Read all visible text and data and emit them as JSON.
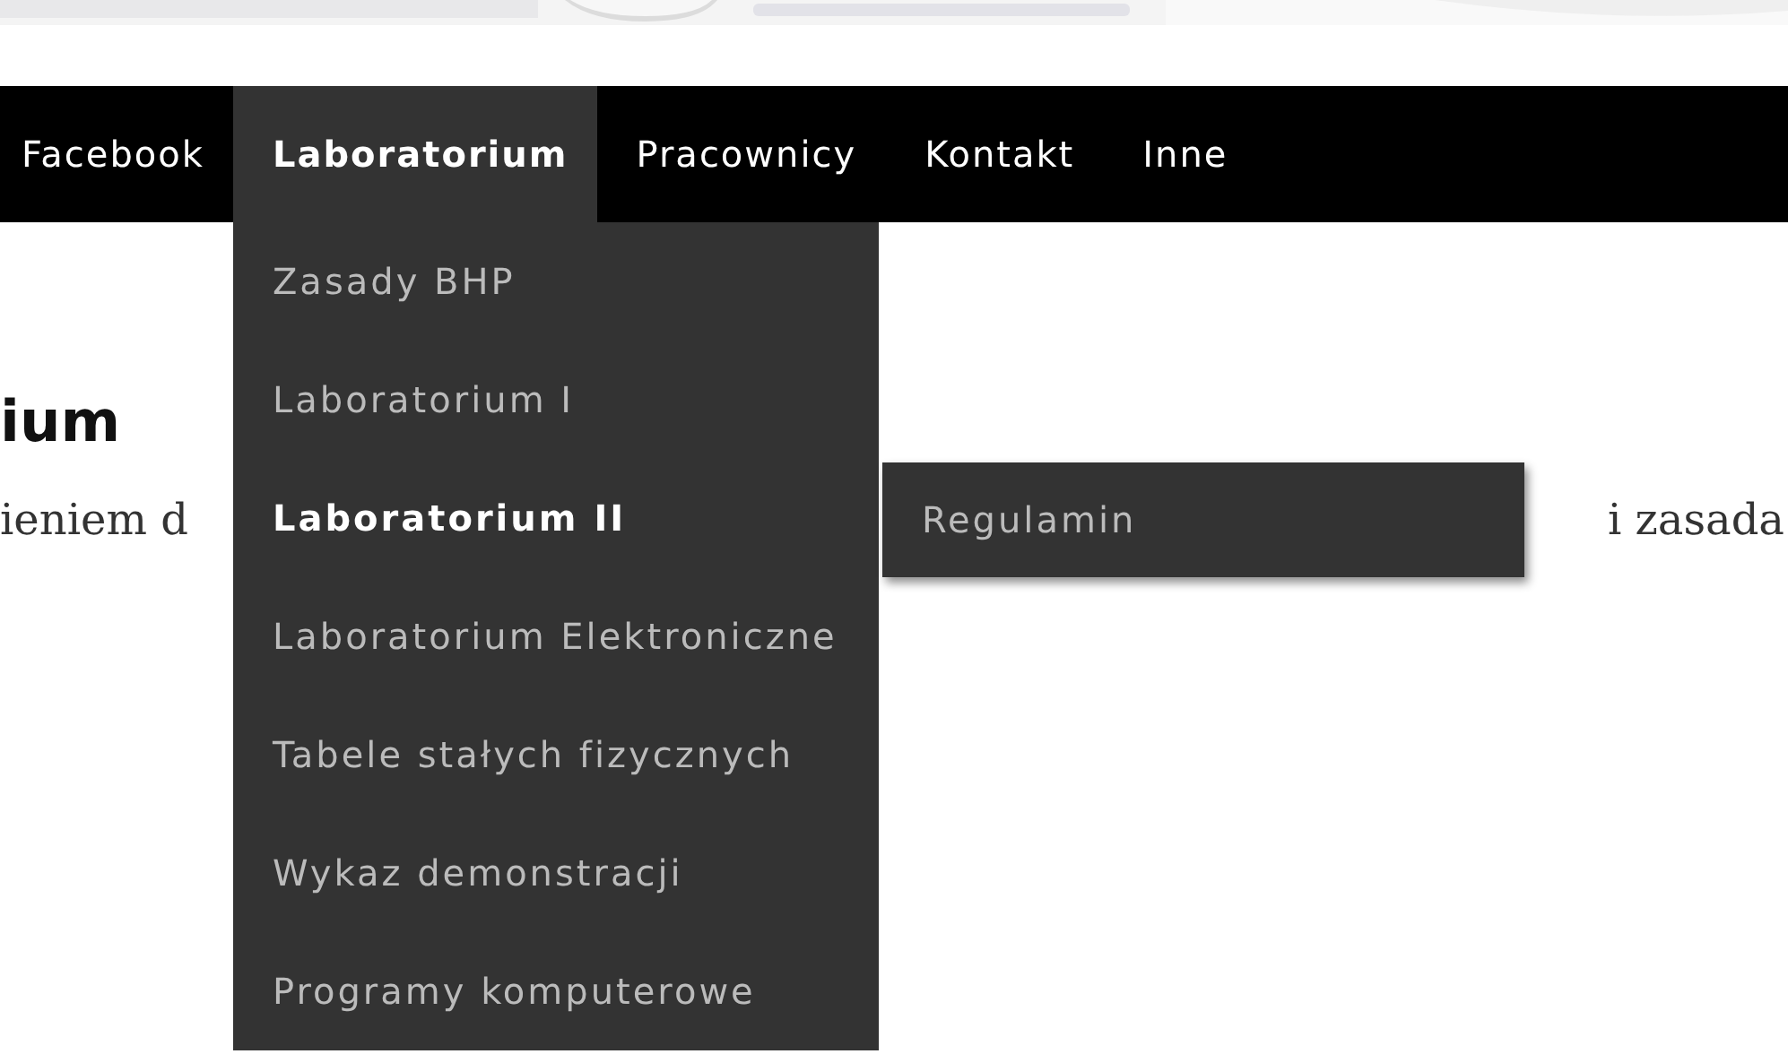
{
  "nav": {
    "items": [
      {
        "label": "Facebook",
        "selected": false
      },
      {
        "label": "Laboratorium",
        "selected": true
      },
      {
        "label": "Pracownicy",
        "selected": false
      },
      {
        "label": "Kontakt",
        "selected": false
      },
      {
        "label": "Inne",
        "selected": false
      }
    ]
  },
  "dropdown": {
    "items": [
      {
        "label": "Zasady BHP",
        "selected": false
      },
      {
        "label": "Laboratorium I",
        "selected": false
      },
      {
        "label": "Laboratorium II",
        "selected": true
      },
      {
        "label": "Laboratorium Elektroniczne",
        "selected": false
      },
      {
        "label": "Tabele stałych fizycznych",
        "selected": false
      },
      {
        "label": "Wykaz demonstracji",
        "selected": false
      },
      {
        "label": "Programy komputerowe",
        "selected": false
      }
    ]
  },
  "submenu": {
    "items": [
      {
        "label": "Regulamin",
        "selected": false
      }
    ]
  },
  "page": {
    "heading": "ium",
    "paragraph_start": "ieniem d",
    "paragraph_end": "i zasada"
  }
}
